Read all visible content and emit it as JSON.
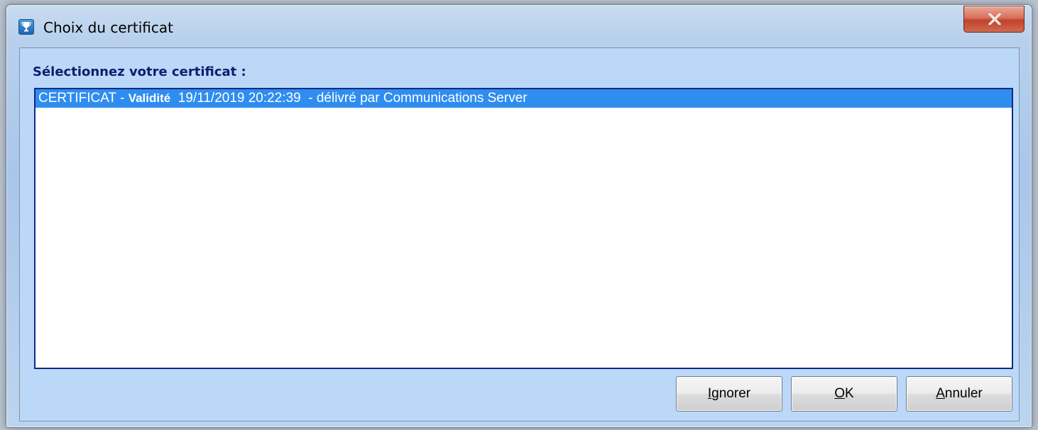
{
  "window": {
    "title": "Choix du certificat",
    "icon": "trophy-icon",
    "close_icon": "close-icon"
  },
  "dialog": {
    "section_label": "Sélectionnez votre certificat :",
    "certificates": [
      {
        "name": "CERTIFICAT - ",
        "validity_label": "Validité",
        "validity_value": "  19/11/2019 20:22:39  - délivré par Communications Server",
        "selected": true
      }
    ]
  },
  "buttons": {
    "ignore": {
      "accel": "I",
      "rest": "gnorer"
    },
    "ok": {
      "accel": "O",
      "rest": "K"
    },
    "cancel": {
      "accel": "A",
      "rest": "nnuler"
    }
  },
  "colors": {
    "selection": "#2f8df0",
    "label_text": "#0a1f6e",
    "list_border": "#112a86"
  }
}
